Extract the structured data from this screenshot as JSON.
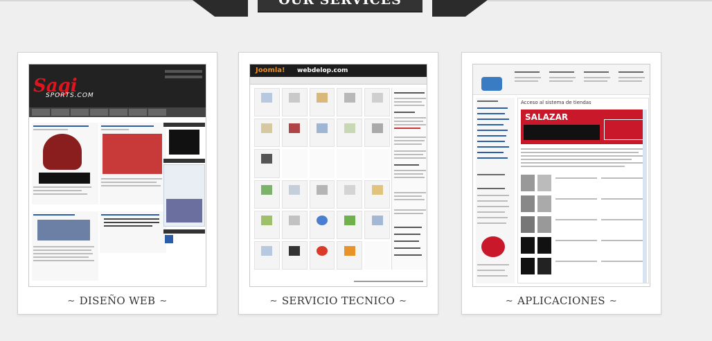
{
  "header": {
    "title": "OUR SERVICES"
  },
  "services": [
    {
      "caption": "DISEÑO WEB",
      "preview_name": "sagi-sports-site"
    },
    {
      "caption": "SERVICIO TECNICO",
      "preview_name": "joomla-admin-panel"
    },
    {
      "caption": "APLICACIONES",
      "preview_name": "tienda-store-app"
    }
  ],
  "decor": {
    "swirl_left": "~",
    "swirl_right": "~"
  },
  "colors": {
    "background": "#efefef",
    "ribbon": "#333333",
    "card": "#ffffff",
    "sagi_red": "#e0141c",
    "joomla_orange": "#f28c1a"
  },
  "preview_text": {
    "sagi_logo": "Sagi",
    "sagi_sub": "SPORTS.COM",
    "joomla_logo": "Joomla!",
    "joomla_site": "webdelop.com",
    "tienda_heading": "Acceso al sistema de tiendas",
    "tienda_brand": "SALAZAR"
  }
}
